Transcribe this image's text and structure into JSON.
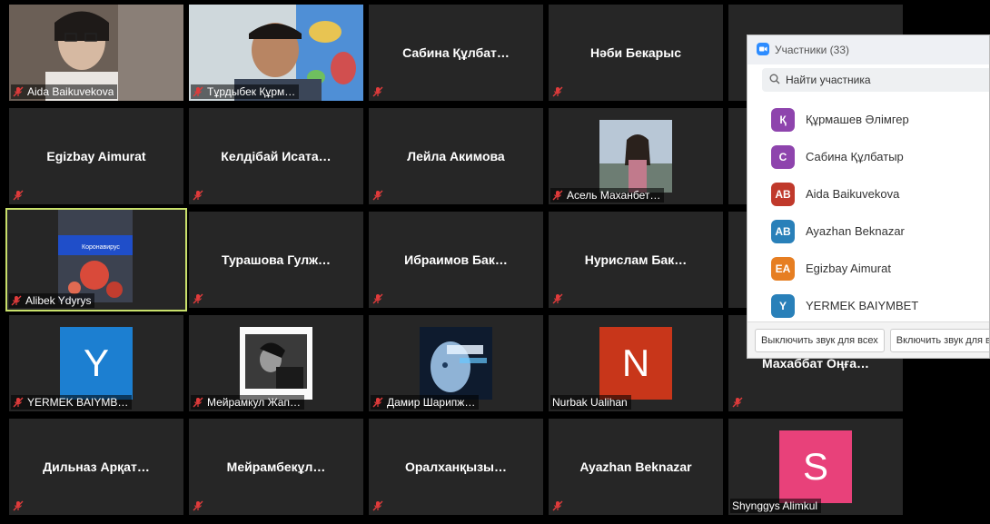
{
  "tiles": [
    {
      "name": "Aida Baikuvekova",
      "mode": "photo",
      "photo": "person-glasses"
    },
    {
      "name": "Тұрдыбек Құрм…",
      "mode": "photo",
      "photo": "person-map"
    },
    {
      "name": "Сабина Құлбат…",
      "mode": "name"
    },
    {
      "name": "Нәби Бекарыс",
      "mode": "name"
    },
    {
      "name": "",
      "mode": "empty"
    },
    {
      "name": "Egizbay Aimurat",
      "mode": "name"
    },
    {
      "name": "Келдібай Исата…",
      "mode": "name"
    },
    {
      "name": "Лейла Акимова",
      "mode": "name"
    },
    {
      "name": "Асель Маханбет…",
      "mode": "photo",
      "photo": "person-outdoor"
    },
    {
      "name": "",
      "mode": "empty"
    },
    {
      "name": "Alibek Ydyrys",
      "mode": "photo",
      "photo": "coronavirus-slide",
      "active": true,
      "slide_text": "Коронавирус"
    },
    {
      "name": "Турашова Гулж…",
      "mode": "name"
    },
    {
      "name": "Ибраимов Бак…",
      "mode": "name"
    },
    {
      "name": "Нурислам Бак…",
      "mode": "name"
    },
    {
      "name": "",
      "mode": "empty"
    },
    {
      "name": "YERMEK BAIYMB…",
      "mode": "avatar",
      "letter": "Y",
      "color": "#1c7fd1"
    },
    {
      "name": "Мейрамкул Жап…",
      "mode": "photo",
      "photo": "bw-photo"
    },
    {
      "name": "Дамир Шарипж…",
      "mode": "photo",
      "photo": "robot-head"
    },
    {
      "name": "Nurbak Ualihan",
      "mode": "avatar",
      "letter": "N",
      "color": "#c8361a"
    },
    {
      "name": "Махаббат Оңға…",
      "mode": "name"
    },
    {
      "name": "Дильназ Арқат…",
      "mode": "name"
    },
    {
      "name": "Мейрамбекұл…",
      "mode": "name"
    },
    {
      "name": "Оралханқызы…",
      "mode": "name"
    },
    {
      "name": "Ayazhan Beknazar",
      "mode": "name"
    },
    {
      "name": "Shynggys Alimkul",
      "mode": "avatar",
      "letter": "S",
      "color": "#e8417a"
    }
  ],
  "panel": {
    "title": "Участники (33)",
    "search_placeholder": "Найти участника",
    "participants": [
      {
        "initials": "Қ",
        "name": "Құрмашев Әлімгер",
        "color": "#8e44ad"
      },
      {
        "initials": "С",
        "name": "Сабина Құлбатыр",
        "color": "#8e44ad"
      },
      {
        "initials": "AB",
        "name": "Aida Baikuvekova",
        "color": "#c0392b"
      },
      {
        "initials": "AB",
        "name": "Ayazhan Beknazar",
        "color": "#2980b9"
      },
      {
        "initials": "EA",
        "name": "Egizbay Aimurat",
        "color": "#e67e22"
      },
      {
        "initials": "Y",
        "name": "YERMEK BAIYMBET",
        "color": "#2980b9"
      }
    ],
    "mute_all": "Выключить звук для всех",
    "unmute_all": "Включить звук для всех"
  },
  "colors": {
    "tile_bg": "#262626",
    "active_border": "#c9e06b",
    "mic_muted": "#e03b3b"
  },
  "icons": {
    "mic": "mic-muted-icon",
    "search": "search-icon",
    "zoom": "zoom-logo-icon"
  }
}
